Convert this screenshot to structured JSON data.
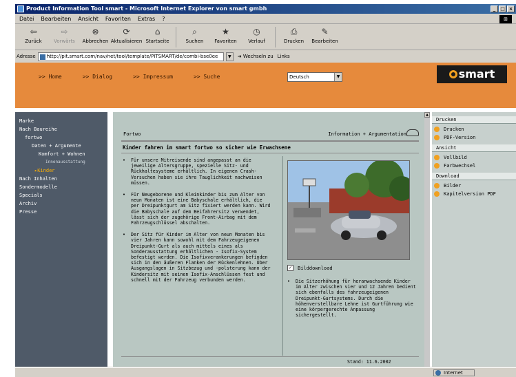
{
  "window": {
    "title": "Product Information Tool smart - Microsoft Internet Explorer von smart gmbh",
    "buttons": [
      "_",
      "□",
      "×"
    ]
  },
  "menubar": [
    "Datei",
    "Bearbeiten",
    "Ansicht",
    "Favoriten",
    "Extras",
    "?"
  ],
  "toolbar": [
    {
      "label": "Zurück",
      "icon": "back-arrow-icon",
      "glyph": "⇦",
      "enabled": true
    },
    {
      "label": "Vorwärts",
      "icon": "forward-arrow-icon",
      "glyph": "⇨",
      "enabled": false
    },
    {
      "label": "Abbrechen",
      "icon": "stop-icon",
      "glyph": "⊗",
      "enabled": true
    },
    {
      "label": "Aktualisieren",
      "icon": "refresh-icon",
      "glyph": "⟳",
      "enabled": true
    },
    {
      "label": "Startseite",
      "icon": "home-icon",
      "glyph": "⌂",
      "enabled": true
    },
    {
      "label": "Suchen",
      "icon": "search-icon",
      "glyph": "⌕",
      "enabled": true
    },
    {
      "label": "Favoriten",
      "icon": "favorites-icon",
      "glyph": "★",
      "enabled": true
    },
    {
      "label": "Verlauf",
      "icon": "history-icon",
      "glyph": "◷",
      "enabled": true
    },
    {
      "label": "Drucken",
      "icon": "print-icon",
      "glyph": "⎙",
      "enabled": true
    },
    {
      "label": "Bearbeiten",
      "icon": "edit-icon",
      "glyph": "✎",
      "enabled": true
    }
  ],
  "address": {
    "label": "Adresse",
    "url": "http://pit.smart.com/nav/net/tool/template/PITSMART/de/combi-bse0ee",
    "go_label": "Wechseln zu",
    "links_label": "Links"
  },
  "header": {
    "nav": [
      "Home",
      "Dialog",
      "Impressum",
      "Suche"
    ],
    "nav_prefix": ">>",
    "language": "Deutsch",
    "logo_text": "smart"
  },
  "sidebar": [
    {
      "label": "Marke",
      "level": 1
    },
    {
      "label": "Nach Baureihe",
      "level": 1
    },
    {
      "label": "fortwo",
      "level": 2
    },
    {
      "label": "Daten + Argumente",
      "level": 3
    },
    {
      "label": "Komfort + Wohnen",
      "level": 4
    },
    {
      "label": "Innenausstattung",
      "level": 5
    },
    {
      "label": "Kinder",
      "level": "active"
    },
    {
      "label": "Nach Inhalten",
      "level": 1
    },
    {
      "label": "Sondermodelle",
      "level": 1
    },
    {
      "label": "Specials",
      "level": 1
    },
    {
      "label": "Archiv",
      "level": 1
    },
    {
      "label": "Presse",
      "level": 1
    }
  ],
  "content": {
    "crumb_left": "Fortwo",
    "crumb_right": "Information + Argumentation",
    "heading": "Kinder fahren im smart fortwo so sicher wie Erwachsene",
    "bullets": [
      "Für unsere Mitreisende sind angepasst an die jeweilige Altersgruppe, spezielle Sitz- und Rückhaltesysteme erhältlich. In eigenen Crash-Versuchen haben sie ihre Tauglichkeit nachweisen müssen.",
      "Für Neugeborene und Kleinkinder bis zum Alter von neun Monaten ist eine Babyschale erhältlich, die per Dreipunktgurt am Sitz fixiert werden kann. Wird die Babyschale auf dem Beifahrersitz verwendet, lässt sich der zugehörige Front-Airbag mit dem Fahrzeugschlüssel abschalten.",
      "Der Sitz für Kinder im Alter von neun Monaten bis vier Jahren kann sowohl mit dem Fahrzeugeigenen Dreipunkt-Gurt als auch mittels eines als Sonderausstattung erhältlichen - Isofix-System befestigt werden. Die Isofixverankerungen befinden sich in den äußeren Flanken der Rückenlehnen. Über Ausgangslagen in Sitzbezug und -polsterung kann der Kindersitz mit seinen Isofix-Anschlüssen fest und schnell mit der Fahrzeug verbunden werden."
    ],
    "photo_caption": "Bilddownload",
    "right_text": "Die Sitzerhöhung für heranwachsende Kinder im Alter zwischen vier und 12 Jahren bedient sich ebenfalls des fahrzeugeigenen Dreipunkt-Gurtsystems. Durch die höhenverstellbare Lehne ist Gurtführung wie eine körpergerechte Anpassung sichergestellt.",
    "stand": "Stand: 11.6.2002"
  },
  "rightpanel": [
    {
      "head": "Drucken",
      "links": [
        "Drucken",
        "PDF-Version"
      ]
    },
    {
      "head": "Ansicht",
      "links": [
        "Vollbild",
        "Farbwechsel"
      ]
    },
    {
      "head": "Download",
      "links": [
        "Bilder",
        "Kapitelversion PDF"
      ]
    }
  ],
  "status": {
    "zone": "Internet"
  },
  "colors": {
    "orange_header": "#e68a3c",
    "sidebar_bg": "#4f5a68",
    "content_bg": "#b9c7c2",
    "accent": "#f0a020"
  }
}
